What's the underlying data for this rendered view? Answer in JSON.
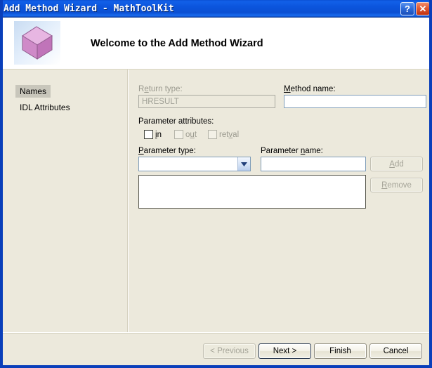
{
  "window": {
    "title": "Add Method Wizard - MathToolKit",
    "help_button": "?",
    "close_button": "✕"
  },
  "header": {
    "icon_name": "pink-cube-icon",
    "title": "Welcome to the Add Method Wizard"
  },
  "sidebar": {
    "items": [
      {
        "label": "Names",
        "selected": true
      },
      {
        "label": "IDL Attributes",
        "selected": false
      }
    ]
  },
  "form": {
    "return_type": {
      "label_prefix": "R",
      "label_mnemonic": "e",
      "label_suffix": "turn type:",
      "value": "HRESULT",
      "placeholder": "",
      "disabled": true
    },
    "method_name": {
      "label_prefix": "",
      "label_mnemonic": "M",
      "label_suffix": "ethod name:",
      "value": "",
      "placeholder": "",
      "disabled": false
    },
    "parameter_attributes": {
      "label": "Parameter attributes:",
      "checkboxes": [
        {
          "label_mnemonic": "i",
          "label_suffix": "n",
          "checked": false,
          "disabled": false
        },
        {
          "label_prefix": "o",
          "label_mnemonic": "u",
          "label_suffix": "t",
          "checked": false,
          "disabled": true
        },
        {
          "label_prefix": "ret",
          "label_mnemonic": "v",
          "label_suffix": "al",
          "checked": false,
          "disabled": true
        }
      ]
    },
    "parameter_type": {
      "label_mnemonic": "P",
      "label_suffix": "arameter type:",
      "value": "",
      "disabled": false
    },
    "parameter_name": {
      "label_prefix": "Parameter ",
      "label_mnemonic": "n",
      "label_suffix": "ame:",
      "value": "",
      "disabled": false
    },
    "parameter_list": {
      "items": []
    },
    "add_button": {
      "label_mnemonic": "A",
      "label_suffix": "dd",
      "disabled": true
    },
    "remove_button": {
      "label_mnemonic": "R",
      "label_suffix": "emove",
      "disabled": true
    }
  },
  "footer": {
    "previous": {
      "label": "< Previous",
      "disabled": true,
      "default": false
    },
    "next": {
      "label": "Next >",
      "disabled": false,
      "default": true
    },
    "finish": {
      "label": "Finish",
      "disabled": false,
      "default": false
    },
    "cancel": {
      "label": "Cancel",
      "disabled": false,
      "default": false
    }
  },
  "colors": {
    "titlebar_blue": "#0b55dd",
    "dialog_beige": "#ece9dc",
    "close_red": "#e05a33",
    "cube_pink": "#d98fd0",
    "selection_grey": "#c8c6bb",
    "input_border_blue": "#7f9db9"
  }
}
